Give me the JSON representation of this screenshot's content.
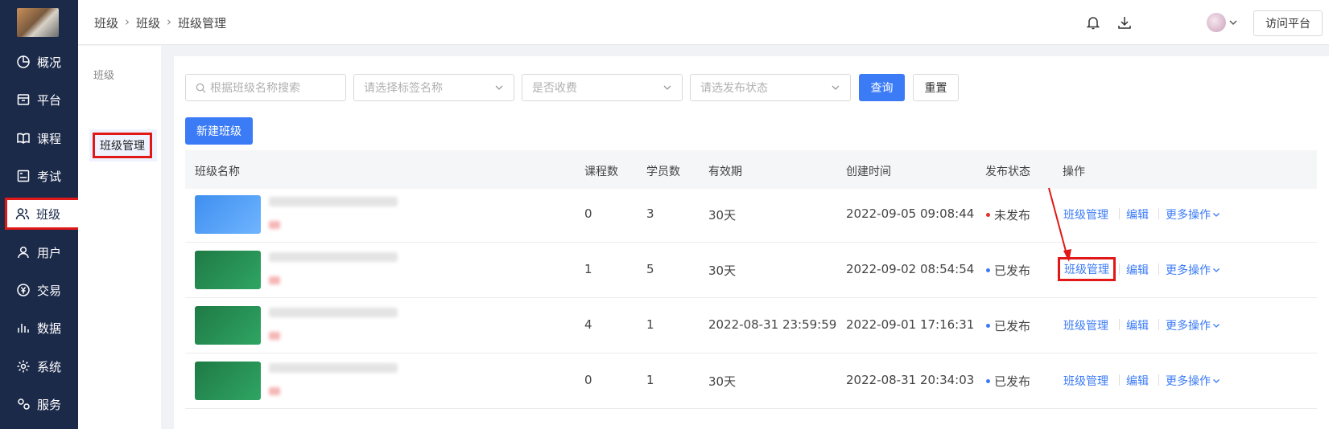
{
  "sidebar": {
    "items": [
      {
        "label": "概况",
        "icon": "pie-chart-icon"
      },
      {
        "label": "平台",
        "icon": "storefront-icon"
      },
      {
        "label": "课程",
        "icon": "book-icon"
      },
      {
        "label": "考试",
        "icon": "exam-icon"
      },
      {
        "label": "班级",
        "icon": "users-icon"
      },
      {
        "label": "用户",
        "icon": "user-icon"
      },
      {
        "label": "交易",
        "icon": "yen-icon"
      },
      {
        "label": "数据",
        "icon": "bar-chart-icon"
      },
      {
        "label": "系统",
        "icon": "gear-icon"
      },
      {
        "label": "服务",
        "icon": "service-icon"
      }
    ]
  },
  "header": {
    "breadcrumb": [
      "班级",
      "班级",
      "班级管理"
    ],
    "visit_label": "访问平台"
  },
  "subnav": {
    "group": "班级",
    "active_item": "班级管理"
  },
  "filters": {
    "search_placeholder": "根据班级名称搜索",
    "tag_placeholder": "请选择标签名称",
    "fee_placeholder": "是否收费",
    "status_placeholder": "请选发布状态",
    "query_label": "查询",
    "reset_label": "重置",
    "new_label": "新建班级"
  },
  "table": {
    "columns": [
      "班级名称",
      "课程数",
      "学员数",
      "有效期",
      "创建时间",
      "发布状态",
      "操作"
    ],
    "rows": [
      {
        "courses": "0",
        "students": "3",
        "validity": "30天",
        "created": "2022-09-05 09:08:44",
        "status": "未发布",
        "status_color": "#e03030",
        "thumb": "blue"
      },
      {
        "courses": "1",
        "students": "5",
        "validity": "30天",
        "created": "2022-09-02 08:54:54",
        "status": "已发布",
        "status_color": "#3b7bf6",
        "thumb": "green"
      },
      {
        "courses": "4",
        "students": "1",
        "validity": "2022-08-31 23:59:59",
        "created": "2022-09-01 17:16:31",
        "status": "已发布",
        "status_color": "#3b7bf6",
        "thumb": "green"
      },
      {
        "courses": "0",
        "students": "1",
        "validity": "30天",
        "created": "2022-08-31 20:34:03",
        "status": "已发布",
        "status_color": "#3b7bf6",
        "thumb": "green"
      }
    ],
    "actions": {
      "manage": "班级管理",
      "edit": "编辑",
      "more": "更多操作"
    }
  }
}
